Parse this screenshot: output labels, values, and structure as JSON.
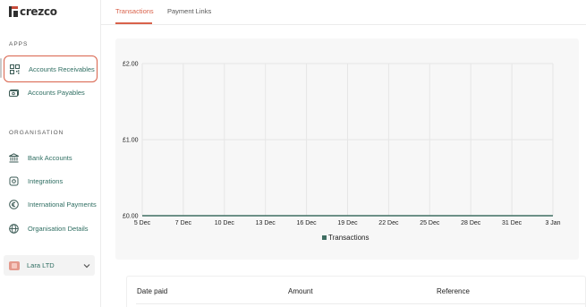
{
  "app": {
    "logo_text": "crezco"
  },
  "sidebar": {
    "apps_title": "APPS",
    "apps": [
      {
        "label": "Accounts Receivables",
        "icon": "qr-code-icon"
      },
      {
        "label": "Accounts Payables",
        "icon": "cash-icon"
      }
    ],
    "org_title": "ORGANISATION",
    "org_items": [
      {
        "label": "Bank Accounts",
        "icon": "bank-icon"
      },
      {
        "label": "Integrations",
        "icon": "cog-icon"
      },
      {
        "label": "International Payments",
        "icon": "euro-icon"
      },
      {
        "label": "Organisation Details",
        "icon": "globe-icon"
      }
    ],
    "org_select": {
      "label": "Lara LTD"
    }
  },
  "tabs": [
    {
      "label": "Transactions",
      "active": true
    },
    {
      "label": "Payment Links",
      "active": false
    }
  ],
  "chart_data": {
    "type": "line",
    "x": [
      "5 Dec",
      "7 Dec",
      "10 Dec",
      "13 Dec",
      "16 Dec",
      "19 Dec",
      "22 Dec",
      "25 Dec",
      "28 Dec",
      "31 Dec",
      "3 Jan"
    ],
    "series": [
      {
        "name": "Transactions",
        "values": [
          0,
          0,
          0,
          0,
          0,
          0,
          0,
          0,
          0,
          0,
          0
        ],
        "color": "#3f6e62"
      }
    ],
    "y_ticks": [
      "£0.00",
      "£1.00",
      "£2.00"
    ],
    "ylim": [
      0,
      2
    ],
    "grid": true,
    "legend": "bottom"
  },
  "table": {
    "columns": [
      "Date paid",
      "Amount",
      "Reference"
    ]
  },
  "colors": {
    "accent": "#d9624b",
    "nav_text": "#2f6e62",
    "series": "#3f6e62"
  }
}
